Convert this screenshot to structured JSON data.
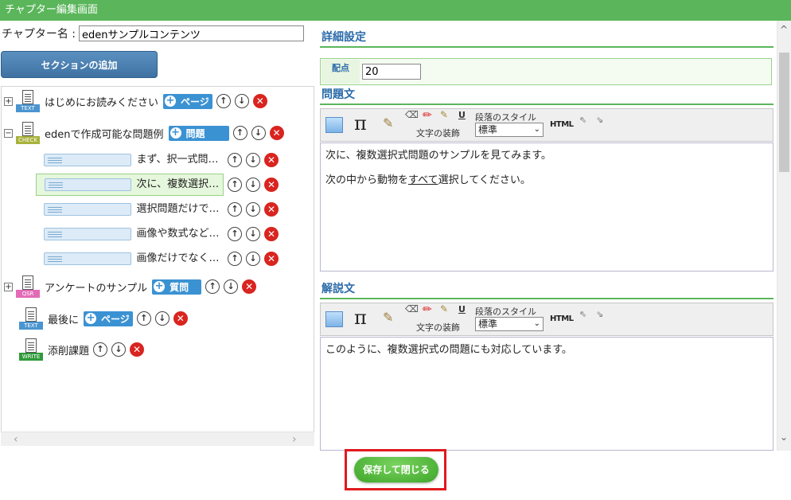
{
  "window": {
    "title": "チャプター編集画面"
  },
  "chapter": {
    "name_label": "チャプター名 :",
    "name_value": "edenサンプルコンテンツ"
  },
  "left": {
    "add_section_label": "セクションの追加",
    "tree": {
      "nodes": [
        {
          "type": "TEXT",
          "expander": "+",
          "label": "はじめにお読みください",
          "pill": "ページ",
          "tag_color": "#4a95d0"
        },
        {
          "type": "CHECK",
          "expander": "−",
          "label": "edenで作成可能な問題例",
          "pill": "問題",
          "tag_color": "#a7b23a"
        },
        {
          "type": "QSR",
          "expander": "+",
          "label": "アンケートのサンプル",
          "pill": "質問",
          "tag_color": "#e36ab6"
        },
        {
          "type": "TEXT",
          "expander": "",
          "label": "最後に",
          "pill": "ページ",
          "tag_color": "#4a95d0"
        },
        {
          "type": "WRITE",
          "expander": "",
          "label": "添削課題",
          "pill": "",
          "tag_color": "#2f9a3a"
        }
      ],
      "questions": [
        {
          "label": "まず、択一式問題のサンプル..."
        },
        {
          "label": "次に、複数選択式問題のサン..."
        },
        {
          "label": "選択問題だけでなく、空欄補..."
        },
        {
          "label": "画像や数式などを問題文や選..."
        },
        {
          "label": "画像だけでなく、動画や音声..."
        }
      ],
      "selected_question_index": 1
    }
  },
  "right": {
    "detail_title": "詳細設定",
    "points_label": "配点",
    "points_value": "20",
    "question_title": "問題文",
    "explanation_title": "解説文",
    "toolbar": {
      "deco_label": "文字の装飾",
      "para_label": "段落のスタイル",
      "para_value": "標準",
      "html_label": "HTML",
      "underline_label": "U"
    },
    "question_text": {
      "line1": "次に、複数選択式問題のサンプルを見てみます。",
      "line2_pre": "次の中から動物を",
      "line2_ul": "すべて",
      "line2_post": "選択してください。"
    },
    "explanation_text": "このように、複数選択式の問題にも対応しています。"
  },
  "footer": {
    "save_label": "保存して閉じる"
  }
}
